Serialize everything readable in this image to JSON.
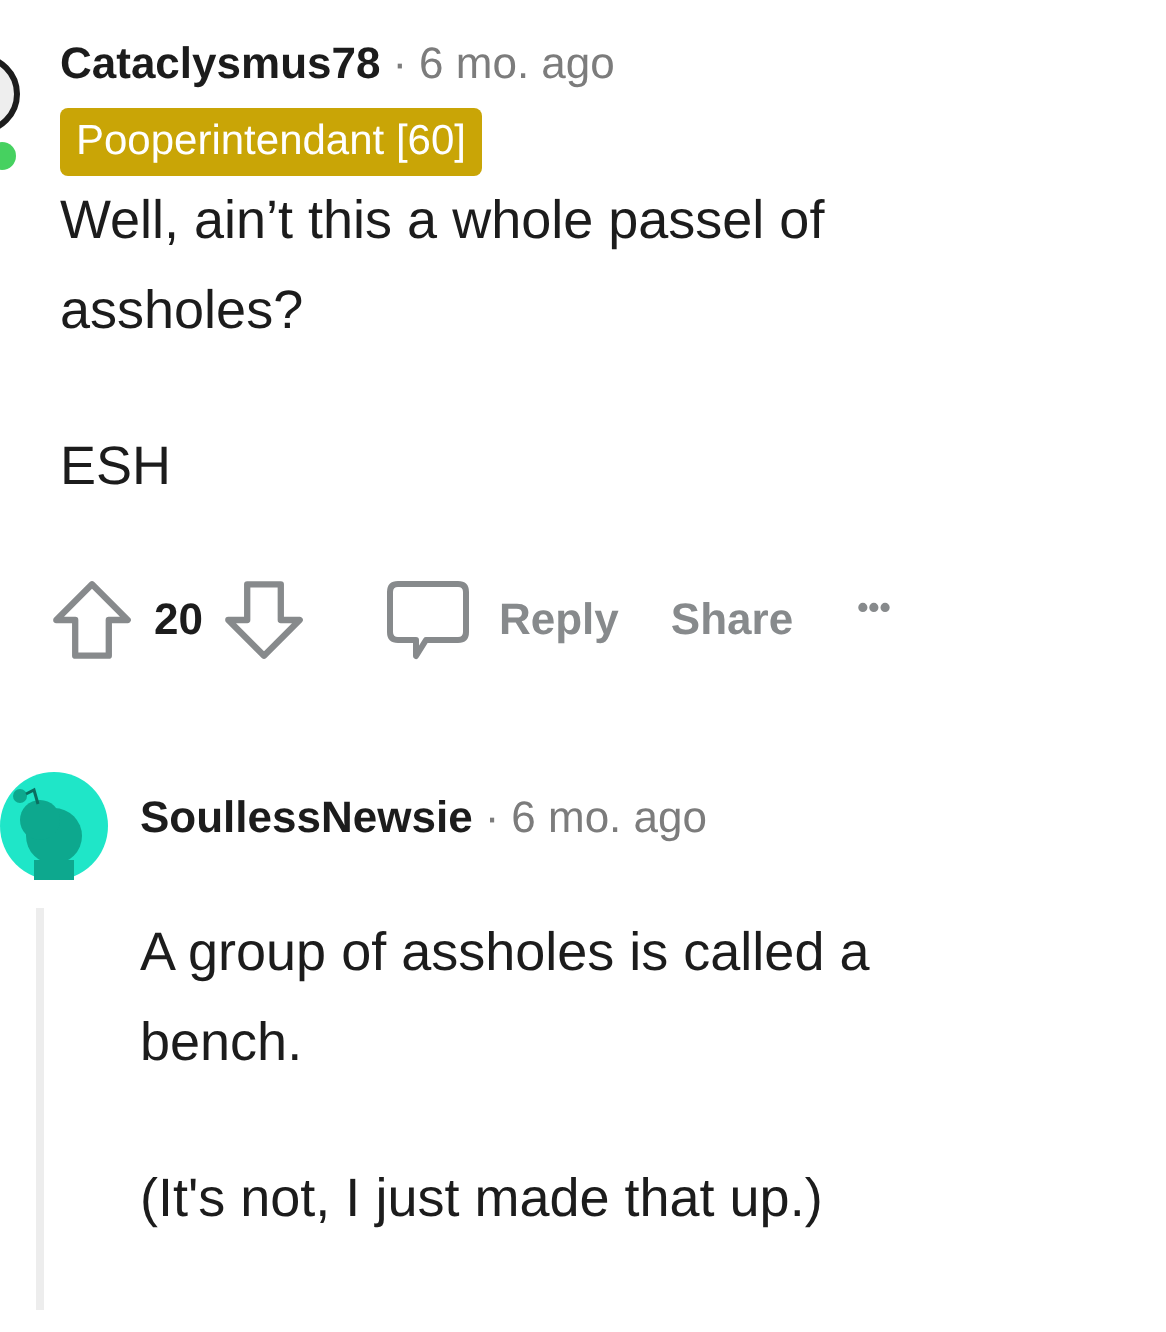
{
  "comments": [
    {
      "author": "Cataclysmus78",
      "separator": "·",
      "time": "6 mo. ago",
      "online": true,
      "flair": "Pooperintendant [60]",
      "paragraphs": [
        "Well, ain’t this a whole passel of assholes?",
        "ESH"
      ],
      "votes": "20",
      "actions": [
        "Reply",
        "Share"
      ],
      "more": "•••"
    },
    {
      "author": "SoullessNewsie",
      "separator": "·",
      "time": "6 mo. ago",
      "online": false,
      "paragraphs": [
        "A group of assholes is called a bench.",
        "(It's not, I just made that up.)"
      ]
    }
  ]
}
